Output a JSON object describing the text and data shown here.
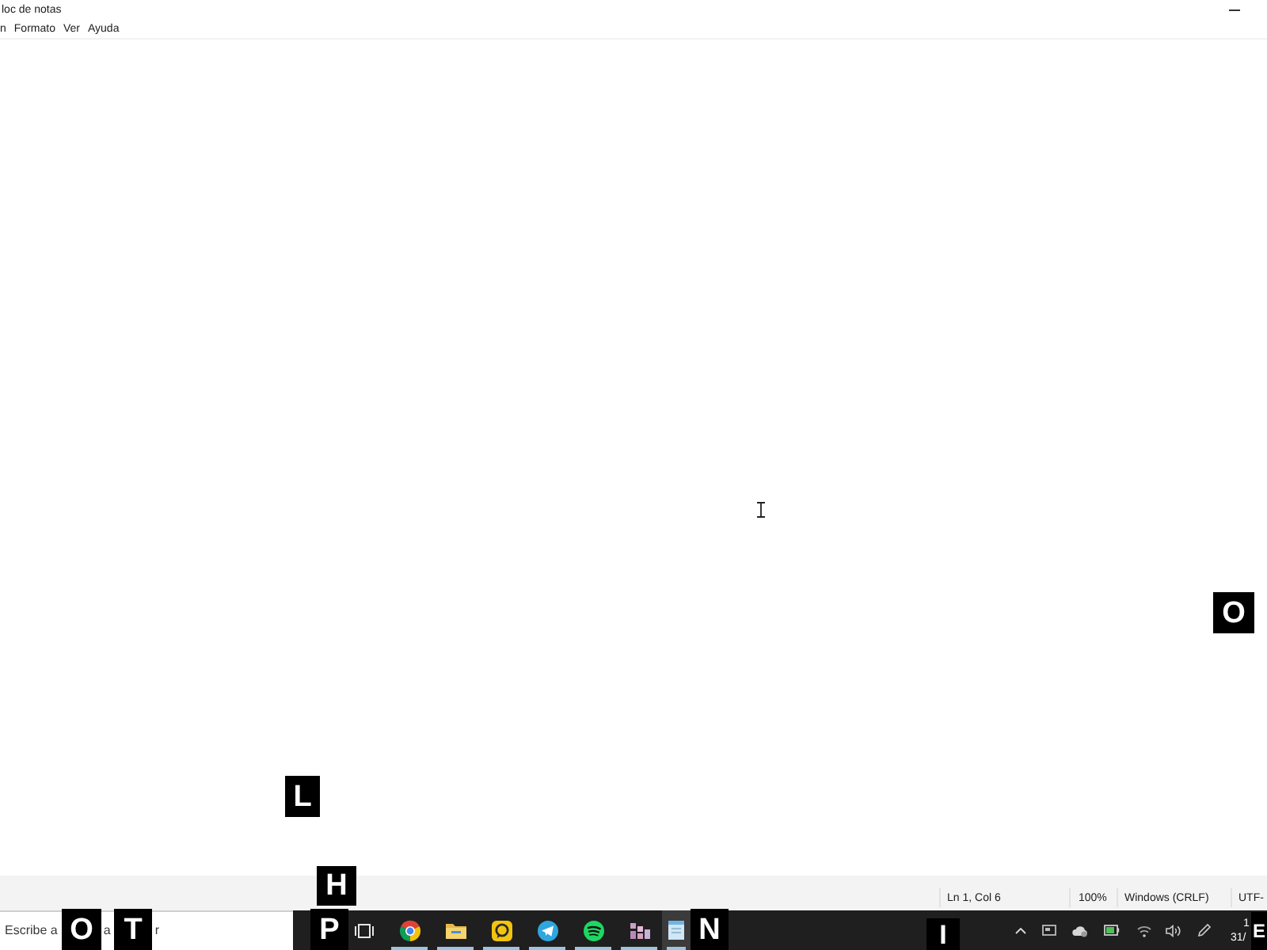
{
  "window": {
    "title": "loc de notas"
  },
  "menu": [
    "n",
    "Formato",
    "Ver",
    "Ayuda"
  ],
  "status_bar": [
    "Ln 1, Col 6",
    "100%",
    "Windows (CRLF)",
    "UTF-"
  ],
  "taskbar": {
    "search": {
      "placeholder_parts": [
        "Escribe a",
        "a",
        "r"
      ]
    },
    "apps": [
      {
        "kind": "browser",
        "running": true,
        "active": false
      },
      {
        "kind": "folder",
        "running": true,
        "active": false
      },
      {
        "kind": "chat",
        "running": true,
        "active": false
      },
      {
        "kind": "messenger",
        "running": true,
        "active": false
      },
      {
        "kind": "music",
        "running": true,
        "active": false
      },
      {
        "kind": "blocks",
        "running": true,
        "active": false
      },
      {
        "kind": "notepad",
        "running": true,
        "active": true
      }
    ],
    "clock": [
      "1",
      "31/"
    ]
  },
  "hint_badges": [
    "O",
    "L",
    "H",
    "O",
    "T",
    "P",
    "N",
    "I",
    "E"
  ]
}
